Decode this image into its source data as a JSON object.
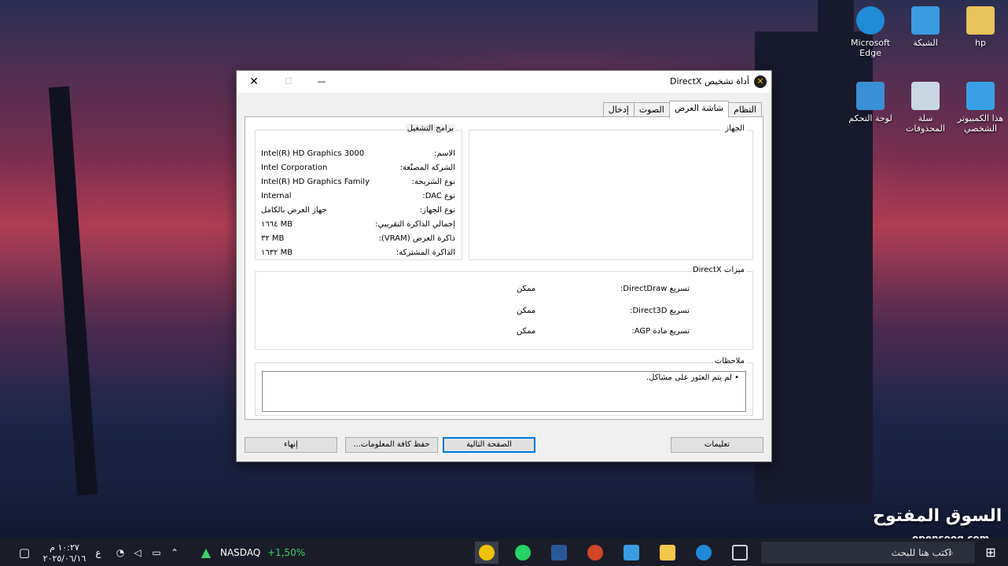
{
  "desktop": {
    "icons": [
      {
        "label": "Microsoft Edge",
        "icon": "edge-icon",
        "color": "#1f8ad6"
      },
      {
        "label": "الشبكة",
        "icon": "network-icon",
        "color": "#3a9be0"
      },
      {
        "label": "hp",
        "icon": "user-folder-icon",
        "color": "#e8c25a"
      },
      {
        "label": "لوحة التحكم",
        "icon": "control-panel-icon",
        "color": "#3b8fd4"
      },
      {
        "label": "سلة المحذوفات",
        "icon": "recycle-bin-icon",
        "color": "#c9d7e2"
      },
      {
        "label": "هذا الكمبيوتر الشخصي",
        "icon": "this-pc-icon",
        "color": "#3aa0e6"
      }
    ]
  },
  "dialog": {
    "title": "أداة تشخيص DirectX",
    "window_controls": {
      "close": "✕",
      "maximize": "☐",
      "minimize": "—"
    },
    "tabs": [
      {
        "label": "النظام",
        "active": false
      },
      {
        "label": "شاشة العرض",
        "active": true
      },
      {
        "label": "الصوت",
        "active": false
      },
      {
        "label": "إدخال",
        "active": false
      }
    ],
    "device_group": {
      "label": "الجهاز",
      "rows": [
        {
          "key": "الاسم:",
          "value": "Intel(R) HD Graphics 3000"
        },
        {
          "key": "الشركة المصنّعة:",
          "value": "Intel Corporation"
        },
        {
          "key": "نوع الشريحة:",
          "value": "Intel(R) HD Graphics Family"
        },
        {
          "key": "نوع DAC:",
          "value": "Internal"
        },
        {
          "key": "نوع الجهاز:",
          "value": "جهاز العرض بالكامل"
        },
        {
          "key": "إجمالي الذاكرة التقريبي:",
          "value": "١٦٦٤ MB"
        },
        {
          "key": "ذاكرة العرض (VRAM):",
          "value": "٣٢ MB"
        },
        {
          "key": "الذاكرة المشتركة:",
          "value": "١٦٣٢ MB"
        }
      ]
    },
    "drivers_group": {
      "label": "برامج التشغيل"
    },
    "directx_features": {
      "label": "ميزات DirectX",
      "rows": [
        {
          "key": "تسريع DirectDraw:",
          "value": "ممكن"
        },
        {
          "key": "تسريع Direct3D:",
          "value": "ممكن"
        },
        {
          "key": "تسريع مادة AGP:",
          "value": "ممكن"
        }
      ]
    },
    "notes": {
      "label": "ملاحظات",
      "items": [
        "لم يتم العثور على مشاكل."
      ]
    },
    "buttons": {
      "help": "تعليمات",
      "next_page": "الصفحة التالية",
      "save_all": "حفظ كافة المعلومات...",
      "exit": "إنهاء"
    }
  },
  "taskbar": {
    "search_placeholder": "اكتب هنا للبحث",
    "stock_name": "NASDAQ",
    "stock_change": "+1,50%",
    "stock_color": "#3fd06a",
    "clock_time": "١٠:٢٧ م",
    "clock_date": "٢٠٢٥/٠٦/١٦",
    "input_lang": "ع",
    "apps": [
      {
        "name": "dxdiag-taskbar-icon",
        "color": "#f2c200"
      },
      {
        "name": "whatsapp-taskbar-icon",
        "color": "#25d366"
      },
      {
        "name": "word-taskbar-icon",
        "color": "#2b579a"
      },
      {
        "name": "powerpoint-taskbar-icon",
        "color": "#d24726"
      },
      {
        "name": "store-taskbar-icon",
        "color": "#3a9be0"
      },
      {
        "name": "explorer-taskbar-icon",
        "color": "#f3c64c"
      },
      {
        "name": "edge-taskbar-icon",
        "color": "#1f8ad6"
      },
      {
        "name": "task-view-icon",
        "color": "#cfd3da"
      }
    ]
  },
  "watermark": {
    "brand": "السوق المفتوح",
    "domain": "opensooq.com"
  }
}
